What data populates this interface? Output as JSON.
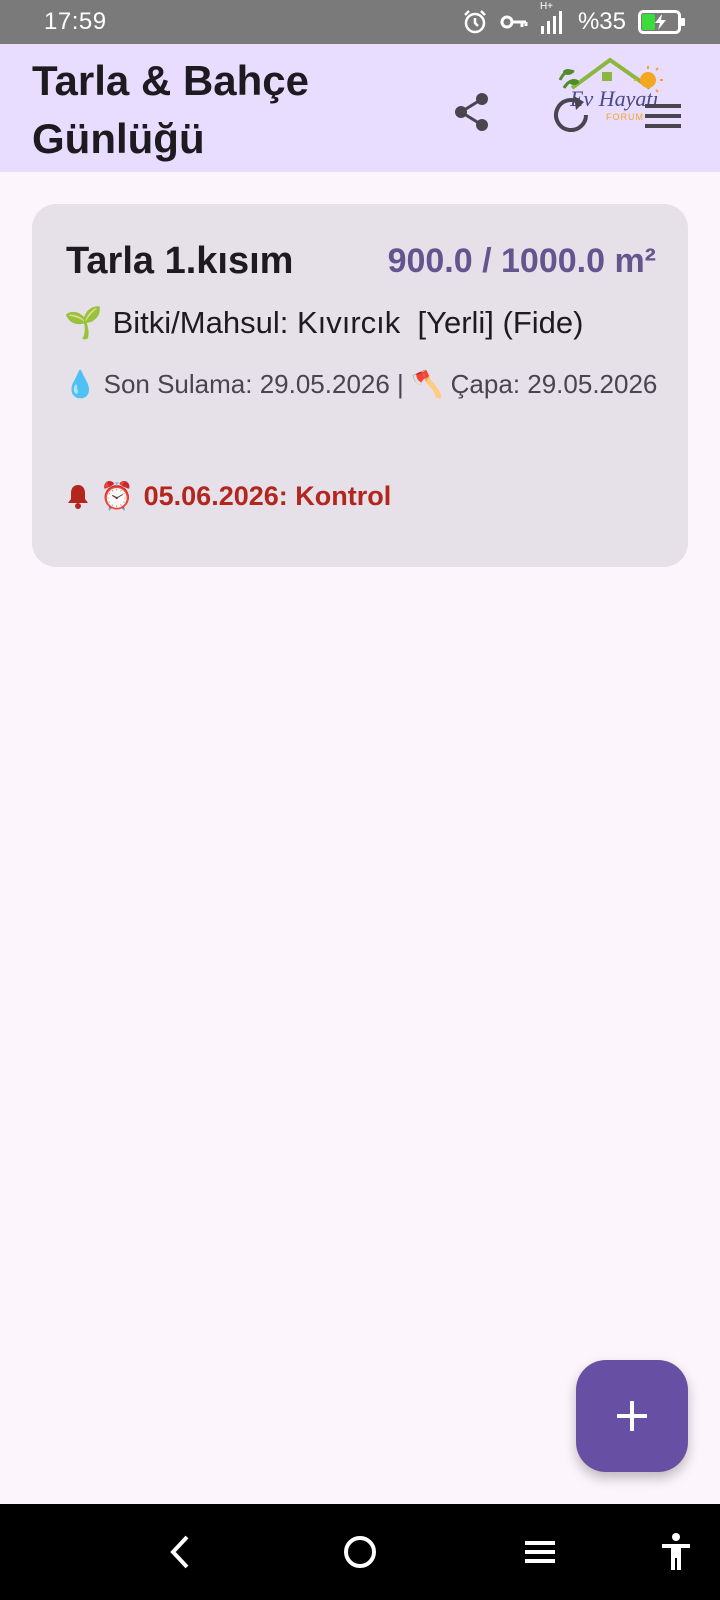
{
  "status_bar": {
    "time": "17:59",
    "network_label": "H+",
    "battery_percent": "%35",
    "battery_level": 0.35,
    "icons": [
      "alarm-icon",
      "vpn-key-icon",
      "signal-icon",
      "battery-charging-icon"
    ]
  },
  "app_bar": {
    "title": "Tarla & Bahçe Günlüğü",
    "logo_text": "Ev Hayatı",
    "logo_subtext": "FORUM",
    "actions": [
      "share-icon",
      "refresh-icon",
      "menu-icon"
    ]
  },
  "fields": [
    {
      "name": "Tarla 1.kısım",
      "area": "900.0 / 1000.0 m²",
      "crop_emoji": "🌱",
      "crop_text": "Bitki/Mahsul: Kıvırcık  [Yerli] (Fide)",
      "water_emoji": "💧",
      "watering_text": "Son Sulama: 29.05.2026 |",
      "hoe_emoji": "🪓",
      "hoeing_text": "Çapa: 29.05.2026",
      "alarm_emoji": "⏰",
      "reminder_text": "05.06.2026: Kontrol"
    }
  ],
  "fab": {
    "icon": "plus-icon"
  },
  "nav_bar": {
    "icons": [
      "back-icon",
      "home-icon",
      "recents-icon",
      "accessibility-icon"
    ]
  },
  "colors": {
    "app_bar_bg": "#e9ddff",
    "page_bg": "#fcf6fc",
    "card_bg": "#e6e0e9",
    "accent": "#65558f",
    "fab_bg": "#6750a4",
    "reminder": "#b3261e"
  }
}
